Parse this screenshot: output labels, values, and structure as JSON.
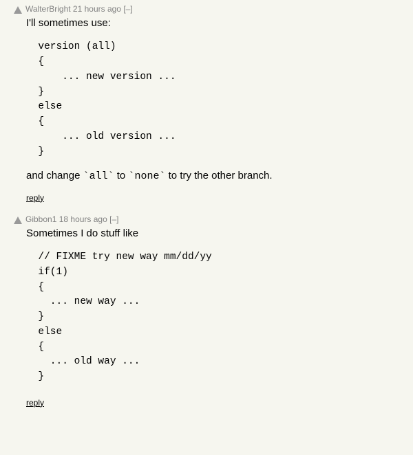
{
  "comments": [
    {
      "username": "WalterBright",
      "age": "21 hours ago",
      "toggle": "[–]",
      "intro": "I'll sometimes use:",
      "code": "  version (all)\n  {\n      ... new version ...\n  }\n  else\n  {\n      ... old version ...\n  }",
      "outro_prefix": "and change ",
      "outro_code1": "`all`",
      "outro_mid": " to ",
      "outro_code2": "`none`",
      "outro_suffix": " to try the other branch.",
      "reply": "reply"
    },
    {
      "username": "Gibbon1",
      "age": "18 hours ago",
      "toggle": "[–]",
      "intro": "Sometimes I do stuff like",
      "code": "  // FIXME try new way mm/dd/yy\n  if(1)\n  {\n    ... new way ...\n  }\n  else\n  {\n    ... old way ...\n  }",
      "reply": "reply"
    }
  ]
}
